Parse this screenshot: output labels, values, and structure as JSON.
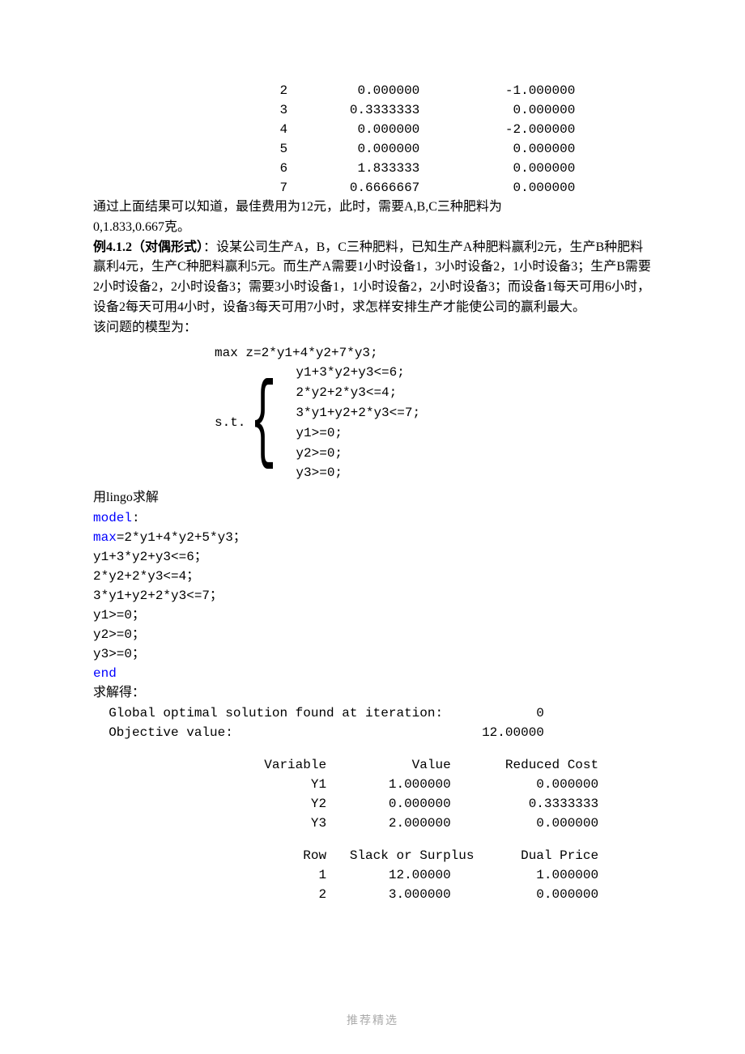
{
  "top_rows": [
    {
      "row": "2",
      "slack": "0.000000",
      "dual": "-1.000000"
    },
    {
      "row": "3",
      "slack": "0.3333333",
      "dual": "0.000000"
    },
    {
      "row": "4",
      "slack": "0.000000",
      "dual": "-2.000000"
    },
    {
      "row": "5",
      "slack": "0.000000",
      "dual": "0.000000"
    },
    {
      "row": "6",
      "slack": "1.833333",
      "dual": "0.000000"
    },
    {
      "row": "7",
      "slack": "0.6666667",
      "dual": "0.000000"
    }
  ],
  "para1_l1": "通过上面结果可以知道，最佳费用为12元，此时，需要A,B,C三种肥料为",
  "para1_l2": "0,1.833,0.667克。",
  "para2_bold": "例4.1.2（对偶形式）",
  "para2_rest": "：设某公司生产A，B，C三种肥料，已知生产A种肥料赢利2元，生产B种肥料赢利4元，生产C种肥料赢利5元。而生产A需要1小时设备1，3小时设备2，1小时设备3；生产B需要 2小时设备2，2小时设备3；需要3小时设备1，1小时设备2，2小时设备3；而设备1每天可用6小时，设备2每天可用4小时，设备3每天可用7小时，求怎样安排生产才能使公司的赢利最大。",
  "model_label": "该问题的模型为：",
  "objective": "max z=2*y1+4*y2+7*y3;",
  "st_label": "s.t.",
  "constraints": [
    "y1+3*y2+y3<=6;",
    "2*y2+2*y3<=4;",
    "3*y1+y2+2*y3<=7;",
    "y1>=0;",
    "y2>=0;",
    "y3>=0;"
  ],
  "lingo_label": "用lingo求解",
  "model_kw": "model",
  "model_colon": ":",
  "max_kw": "max",
  "max_rest": "=2*y1+4*y2+5*y3；",
  "lingo_lines": [
    "y1+3*y2+y3<=6；",
    "2*y2+2*y3<=4；",
    "3*y1+y2+2*y3<=7；",
    "y1>=0；",
    "y2>=0；",
    "y3>=0；"
  ],
  "end_kw": "end",
  "solve_label": "求解得：",
  "sol_line1_label": "Global optimal solution found at iteration:",
  "sol_line1_val": "0",
  "sol_line2_label": "Objective value:",
  "sol_line2_val": "12.00000",
  "var_header": {
    "c1": "Variable",
    "c2": "Value",
    "c3": "Reduced Cost"
  },
  "var_rows": [
    {
      "c1": "Y1",
      "c2": "1.000000",
      "c3": "0.000000"
    },
    {
      "c1": "Y2",
      "c2": "0.000000",
      "c3": "0.3333333"
    },
    {
      "c1": "Y3",
      "c2": "2.000000",
      "c3": "0.000000"
    }
  ],
  "row_header": {
    "c1": "Row",
    "c2": "Slack or Surplus",
    "c3": "Dual Price"
  },
  "row_rows": [
    {
      "c1": "1",
      "c2": "12.00000",
      "c3": "1.000000"
    },
    {
      "c1": "2",
      "c2": "3.000000",
      "c3": "0.000000"
    }
  ],
  "footer": "推荐精选"
}
